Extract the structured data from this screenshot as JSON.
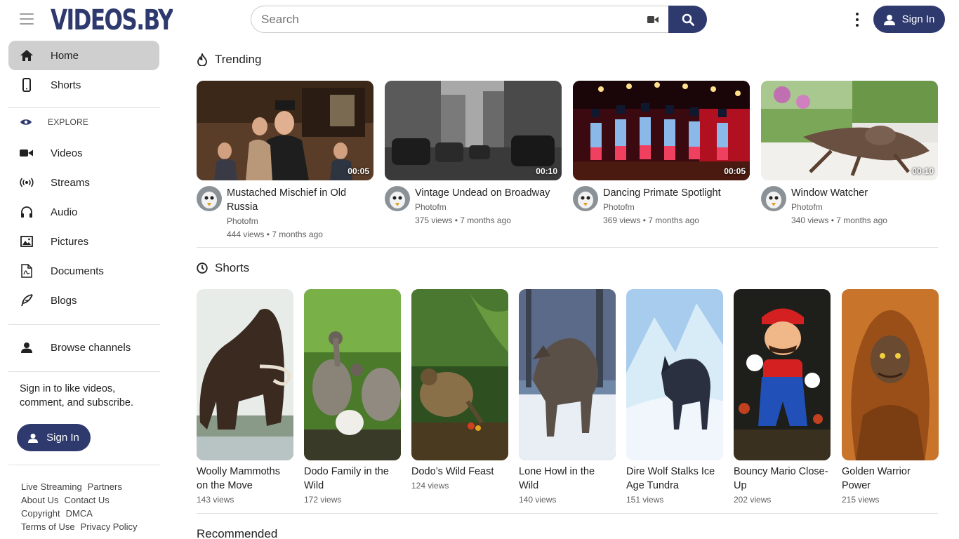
{
  "header": {
    "logo_text": "VIDEOS.BY",
    "search_placeholder": "Search",
    "signin_label": "Sign In"
  },
  "sidebar": {
    "items": [
      {
        "label": "Home",
        "icon": "home-icon"
      },
      {
        "label": "Shorts",
        "icon": "phone-icon"
      }
    ],
    "explore_label": "EXPLORE",
    "explore_items": [
      {
        "label": "Videos",
        "icon": "video-camera-icon"
      },
      {
        "label": "Streams",
        "icon": "broadcast-icon"
      },
      {
        "label": "Audio",
        "icon": "headphones-icon"
      },
      {
        "label": "Pictures",
        "icon": "picture-icon"
      },
      {
        "label": "Documents",
        "icon": "document-icon"
      },
      {
        "label": "Blogs",
        "icon": "feather-icon"
      }
    ],
    "browse_channels": "Browse channels",
    "signin_message": "Sign in to like videos, comment, and subscribe.",
    "signin_label": "Sign In",
    "footer_links": [
      "Live Streaming",
      "Partners",
      "About Us",
      "Contact Us",
      "Copyright",
      "DMCA",
      "Terms of Use",
      "Privacy Policy"
    ]
  },
  "main": {
    "trending_title": "Trending",
    "trending": [
      {
        "title": "Mustached Mischief in Old Russia",
        "channel": "Photofm",
        "stats": "444 views • 7 months ago",
        "duration": "00:05"
      },
      {
        "title": "Vintage Undead on Broadway",
        "channel": "Photofm",
        "stats": "375 views • 7 months ago",
        "duration": "00:10"
      },
      {
        "title": "Dancing Primate Spotlight",
        "channel": "Photofm",
        "stats": "369 views • 7 months ago",
        "duration": "00:05"
      },
      {
        "title": "Window Watcher",
        "channel": "Photofm",
        "stats": "340 views • 7 months ago",
        "duration": "00:10"
      }
    ],
    "shorts_title": "Shorts",
    "shorts": [
      {
        "title": "Woolly Mammoths on the Move",
        "stats": "143 views"
      },
      {
        "title": "Dodo Family in the Wild",
        "stats": "172 views"
      },
      {
        "title": "Dodo’s Wild Feast",
        "stats": "124 views"
      },
      {
        "title": "Lone Howl in the Wild",
        "stats": "140 views"
      },
      {
        "title": "Dire Wolf Stalks Ice Age Tundra",
        "stats": "151 views"
      },
      {
        "title": "Bouncy Mario Close-Up",
        "stats": "202 views"
      },
      {
        "title": "Golden Warrior Power",
        "stats": "215 views"
      }
    ],
    "recommended_title": "Recommended"
  },
  "colors": {
    "brand": "#2e3a6e",
    "active_bg": "#cfcfcf"
  }
}
